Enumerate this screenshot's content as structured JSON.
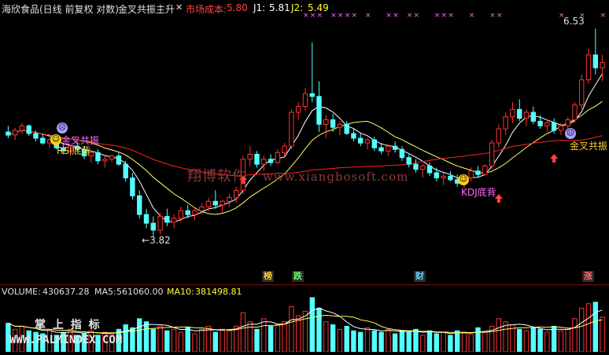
{
  "header": {
    "stock": "海欣食品(日线 前复权 对数)",
    "indicator": "金叉共振主升",
    "close_icon": "close-x-icon",
    "cost_label": "市场成本:",
    "cost_value": "5.80",
    "j1_label": "J1:",
    "j1_value": "5.81",
    "j2_label": "J2:",
    "j2_value": "5.49"
  },
  "price": {
    "high_label": "6.53",
    "low_label": "3.82",
    "ymin": 3.6,
    "ymax": 6.75
  },
  "signals": {
    "jincha_left": "金叉共振",
    "rsi_dibei": "RSI底背",
    "kdj_dibei": "KDJ底背",
    "jincha_right": "金叉共振"
  },
  "watermark": {
    "cn": "翔博软件",
    "url": "www.xiangbosoft.com"
  },
  "markers": {
    "bang": "榜",
    "die": "跌",
    "cai": "财",
    "zhang": "涨"
  },
  "volume": {
    "vol_label": "VOLUME:",
    "vol_value": "430637.28",
    "ma5_label": "MA5:",
    "ma5_value": "561060.00",
    "ma10_label": "MA10:",
    "ma10_value": "381498.81"
  },
  "brand": {
    "title": "掌 上 指 标",
    "url": "WWW.PALMINDEX.COM"
  },
  "colors": {
    "up": "#ff3333",
    "down": "#54ffff",
    "ma_white": "#ffffff",
    "ma_yellow": "#ffff66",
    "ma_red": "#ff2222",
    "header_white": "#e0e0e0",
    "cost": "#ff4444",
    "j1": "#ffffff",
    "j2": "#ffff33",
    "signal_pink": "#ff66ff",
    "signal_yellow": "#ffcc33"
  },
  "candles": [
    {
      "o": 5.0,
      "h": 5.08,
      "l": 4.92,
      "c": 4.96
    },
    {
      "o": 4.96,
      "h": 5.05,
      "l": 4.9,
      "c": 5.02
    },
    {
      "o": 5.02,
      "h": 5.12,
      "l": 4.98,
      "c": 5.08
    },
    {
      "o": 5.08,
      "h": 5.1,
      "l": 4.95,
      "c": 4.98
    },
    {
      "o": 4.98,
      "h": 5.02,
      "l": 4.88,
      "c": 4.92
    },
    {
      "o": 4.92,
      "h": 4.98,
      "l": 4.84,
      "c": 4.86
    },
    {
      "o": 4.86,
      "h": 4.92,
      "l": 4.8,
      "c": 4.9
    },
    {
      "o": 4.9,
      "h": 4.94,
      "l": 4.78,
      "c": 4.8
    },
    {
      "o": 4.8,
      "h": 4.86,
      "l": 4.72,
      "c": 4.76
    },
    {
      "o": 4.76,
      "h": 4.84,
      "l": 4.7,
      "c": 4.82
    },
    {
      "o": 4.82,
      "h": 4.88,
      "l": 4.76,
      "c": 4.78
    },
    {
      "o": 4.78,
      "h": 4.82,
      "l": 4.66,
      "c": 4.7
    },
    {
      "o": 4.7,
      "h": 4.76,
      "l": 4.62,
      "c": 4.74
    },
    {
      "o": 4.74,
      "h": 4.78,
      "l": 4.6,
      "c": 4.64
    },
    {
      "o": 4.64,
      "h": 4.7,
      "l": 4.56,
      "c": 4.66
    },
    {
      "o": 4.66,
      "h": 4.72,
      "l": 4.62,
      "c": 4.7
    },
    {
      "o": 4.7,
      "h": 4.74,
      "l": 4.58,
      "c": 4.6
    },
    {
      "o": 4.6,
      "h": 4.64,
      "l": 4.4,
      "c": 4.44
    },
    {
      "o": 4.44,
      "h": 4.5,
      "l": 4.2,
      "c": 4.24
    },
    {
      "o": 4.24,
      "h": 4.3,
      "l": 4.0,
      "c": 4.04
    },
    {
      "o": 4.04,
      "h": 4.1,
      "l": 3.9,
      "c": 3.95
    },
    {
      "o": 3.95,
      "h": 4.02,
      "l": 3.82,
      "c": 3.88
    },
    {
      "o": 3.88,
      "h": 4.06,
      "l": 3.84,
      "c": 4.02
    },
    {
      "o": 4.02,
      "h": 4.1,
      "l": 3.92,
      "c": 3.96
    },
    {
      "o": 3.96,
      "h": 4.04,
      "l": 3.9,
      "c": 4.0
    },
    {
      "o": 4.0,
      "h": 4.12,
      "l": 3.96,
      "c": 4.08
    },
    {
      "o": 4.08,
      "h": 4.14,
      "l": 4.0,
      "c": 4.04
    },
    {
      "o": 4.04,
      "h": 4.1,
      "l": 3.98,
      "c": 4.08
    },
    {
      "o": 4.08,
      "h": 4.16,
      "l": 4.04,
      "c": 4.12
    },
    {
      "o": 4.12,
      "h": 4.22,
      "l": 4.08,
      "c": 4.18
    },
    {
      "o": 4.18,
      "h": 4.3,
      "l": 4.1,
      "c": 4.14
    },
    {
      "o": 4.14,
      "h": 4.2,
      "l": 4.06,
      "c": 4.18
    },
    {
      "o": 4.18,
      "h": 4.26,
      "l": 4.12,
      "c": 4.22
    },
    {
      "o": 4.22,
      "h": 4.34,
      "l": 4.16,
      "c": 4.3
    },
    {
      "o": 4.3,
      "h": 4.7,
      "l": 4.26,
      "c": 4.66
    },
    {
      "o": 4.66,
      "h": 4.82,
      "l": 4.58,
      "c": 4.72
    },
    {
      "o": 4.72,
      "h": 4.76,
      "l": 4.56,
      "c": 4.6
    },
    {
      "o": 4.6,
      "h": 4.7,
      "l": 4.52,
      "c": 4.66
    },
    {
      "o": 4.66,
      "h": 4.72,
      "l": 4.58,
      "c": 4.62
    },
    {
      "o": 4.62,
      "h": 4.78,
      "l": 4.6,
      "c": 4.74
    },
    {
      "o": 4.74,
      "h": 4.86,
      "l": 4.7,
      "c": 4.82
    },
    {
      "o": 4.82,
      "h": 5.3,
      "l": 4.78,
      "c": 5.26
    },
    {
      "o": 5.26,
      "h": 5.4,
      "l": 5.16,
      "c": 5.34
    },
    {
      "o": 5.34,
      "h": 5.6,
      "l": 5.28,
      "c": 5.52
    },
    {
      "o": 5.52,
      "h": 6.3,
      "l": 5.4,
      "c": 5.48
    },
    {
      "o": 5.48,
      "h": 5.7,
      "l": 5.0,
      "c": 5.1
    },
    {
      "o": 5.1,
      "h": 5.22,
      "l": 4.92,
      "c": 5.16
    },
    {
      "o": 5.16,
      "h": 5.24,
      "l": 5.0,
      "c": 5.06
    },
    {
      "o": 5.06,
      "h": 5.14,
      "l": 4.96,
      "c": 5.1
    },
    {
      "o": 5.1,
      "h": 5.14,
      "l": 4.96,
      "c": 4.98
    },
    {
      "o": 4.98,
      "h": 5.04,
      "l": 4.88,
      "c": 4.92
    },
    {
      "o": 4.92,
      "h": 4.98,
      "l": 4.82,
      "c": 4.86
    },
    {
      "o": 4.86,
      "h": 4.92,
      "l": 4.78,
      "c": 4.9
    },
    {
      "o": 4.9,
      "h": 4.94,
      "l": 4.76,
      "c": 4.8
    },
    {
      "o": 4.8,
      "h": 4.86,
      "l": 4.72,
      "c": 4.76
    },
    {
      "o": 4.76,
      "h": 4.84,
      "l": 4.7,
      "c": 4.82
    },
    {
      "o": 4.82,
      "h": 4.88,
      "l": 4.74,
      "c": 4.78
    },
    {
      "o": 4.78,
      "h": 4.82,
      "l": 4.64,
      "c": 4.68
    },
    {
      "o": 4.68,
      "h": 4.72,
      "l": 4.56,
      "c": 4.6
    },
    {
      "o": 4.6,
      "h": 4.66,
      "l": 4.5,
      "c": 4.54
    },
    {
      "o": 4.54,
      "h": 4.6,
      "l": 4.44,
      "c": 4.58
    },
    {
      "o": 4.58,
      "h": 4.62,
      "l": 4.46,
      "c": 4.5
    },
    {
      "o": 4.5,
      "h": 4.56,
      "l": 4.4,
      "c": 4.44
    },
    {
      "o": 4.44,
      "h": 4.5,
      "l": 4.36,
      "c": 4.46
    },
    {
      "o": 4.46,
      "h": 4.52,
      "l": 4.4,
      "c": 4.42
    },
    {
      "o": 4.42,
      "h": 4.48,
      "l": 4.34,
      "c": 4.38
    },
    {
      "o": 4.38,
      "h": 4.46,
      "l": 4.32,
      "c": 4.44
    },
    {
      "o": 4.44,
      "h": 4.56,
      "l": 4.4,
      "c": 4.52
    },
    {
      "o": 4.52,
      "h": 4.58,
      "l": 4.44,
      "c": 4.48
    },
    {
      "o": 4.48,
      "h": 4.6,
      "l": 4.46,
      "c": 4.58
    },
    {
      "o": 4.58,
      "h": 4.9,
      "l": 4.54,
      "c": 4.86
    },
    {
      "o": 4.86,
      "h": 5.1,
      "l": 4.8,
      "c": 5.04
    },
    {
      "o": 5.04,
      "h": 5.26,
      "l": 4.96,
      "c": 5.2
    },
    {
      "o": 5.2,
      "h": 5.4,
      "l": 5.12,
      "c": 5.3
    },
    {
      "o": 5.3,
      "h": 5.44,
      "l": 5.14,
      "c": 5.18
    },
    {
      "o": 5.18,
      "h": 5.3,
      "l": 5.08,
      "c": 5.26
    },
    {
      "o": 5.26,
      "h": 5.34,
      "l": 5.1,
      "c": 5.14
    },
    {
      "o": 5.14,
      "h": 5.22,
      "l": 5.04,
      "c": 5.08
    },
    {
      "o": 5.08,
      "h": 5.16,
      "l": 5.0,
      "c": 5.12
    },
    {
      "o": 5.12,
      "h": 5.18,
      "l": 4.98,
      "c": 5.02
    },
    {
      "o": 5.02,
      "h": 5.12,
      "l": 4.96,
      "c": 5.08
    },
    {
      "o": 5.08,
      "h": 5.2,
      "l": 5.04,
      "c": 5.16
    },
    {
      "o": 5.16,
      "h": 5.4,
      "l": 5.12,
      "c": 5.36
    },
    {
      "o": 5.36,
      "h": 5.8,
      "l": 5.3,
      "c": 5.72
    },
    {
      "o": 5.72,
      "h": 6.2,
      "l": 5.66,
      "c": 6.1
    },
    {
      "o": 6.1,
      "h": 6.53,
      "l": 5.8,
      "c": 5.9
    },
    {
      "o": 5.9,
      "h": 6.1,
      "l": 5.7,
      "c": 5.98
    }
  ],
  "vols": [
    38,
    30,
    34,
    28,
    26,
    24,
    30,
    22,
    26,
    30,
    22,
    24,
    28,
    22,
    26,
    24,
    30,
    36,
    32,
    44,
    40,
    30,
    34,
    28,
    30,
    26,
    32,
    24,
    30,
    34,
    26,
    30,
    28,
    34,
    52,
    40,
    30,
    44,
    34,
    36,
    40,
    60,
    48,
    54,
    72,
    58,
    40,
    36,
    30,
    34,
    28,
    26,
    32,
    28,
    26,
    30,
    24,
    28,
    26,
    30,
    22,
    28,
    24,
    26,
    22,
    28,
    26,
    24,
    32,
    26,
    34,
    44,
    40,
    36,
    30,
    28,
    32,
    30,
    26,
    34,
    28,
    30,
    44,
    58,
    64,
    66,
    46
  ]
}
